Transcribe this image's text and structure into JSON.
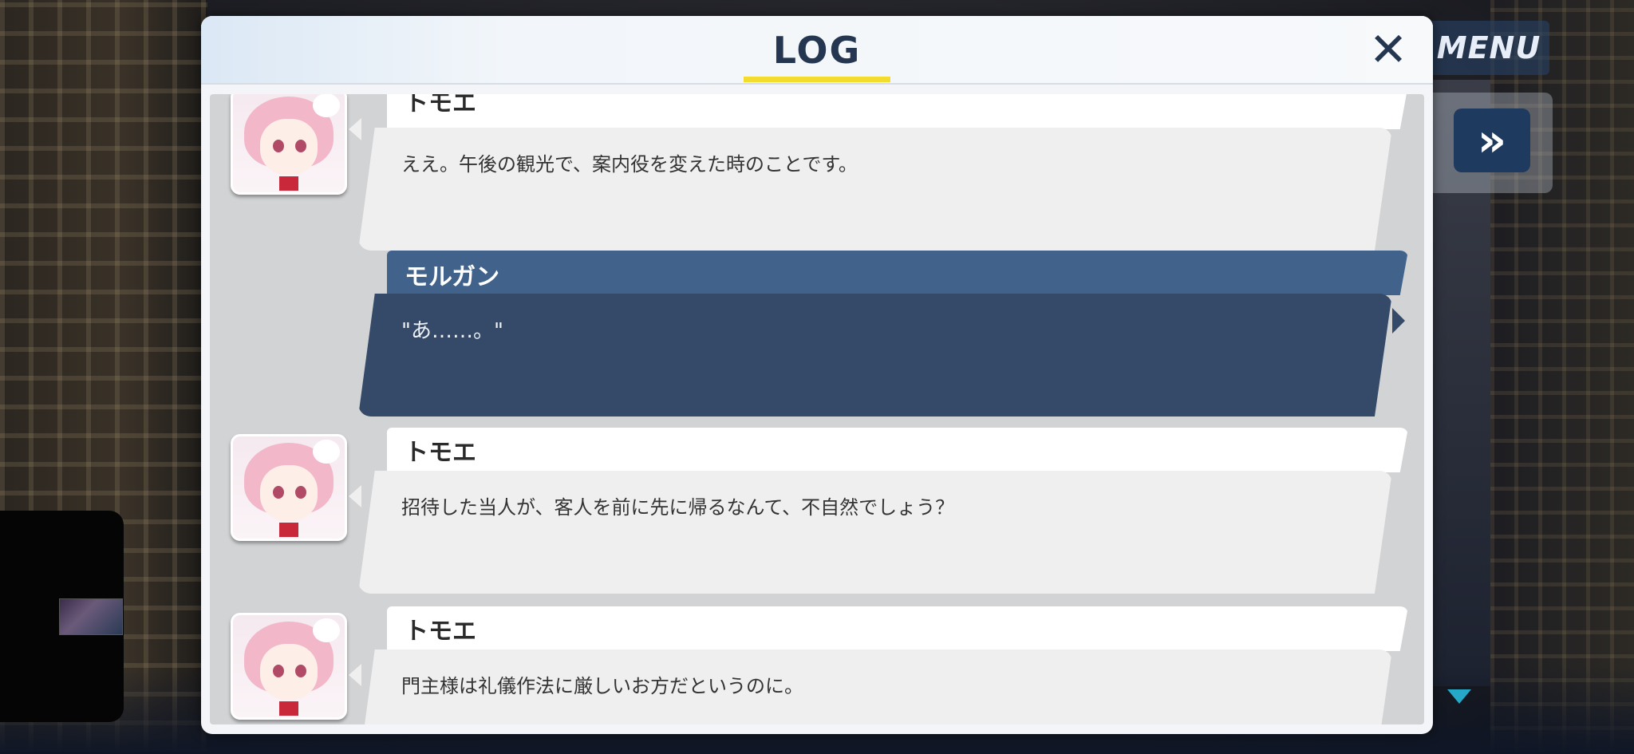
{
  "hud": {
    "menu_label": "MENU",
    "fast_forward_label": "»"
  },
  "log": {
    "title": "LOG",
    "close_label": "✕",
    "entries": [
      {
        "speaker": "トモエ",
        "text": "ええ。午後の観光で、案内役を変えた時のことです。",
        "is_player": false
      },
      {
        "speaker": "モルガン",
        "text": "\"あ……。\"",
        "is_player": true
      },
      {
        "speaker": "トモエ",
        "text": "招待した当人が、客人を前に先に帰るなんて、不自然でしょう？",
        "is_player": false
      },
      {
        "speaker": "トモエ",
        "text": "門主様は礼儀作法に厳しいお方だというのに。",
        "is_player": false
      }
    ]
  },
  "colors": {
    "accent_underline": "#f4dc2f",
    "title_text": "#243650",
    "player_namebar": "#41638b",
    "player_bubble": "#344a68",
    "npc_bubble": "#efefef",
    "scroll_indicator": "#26a9c9"
  }
}
